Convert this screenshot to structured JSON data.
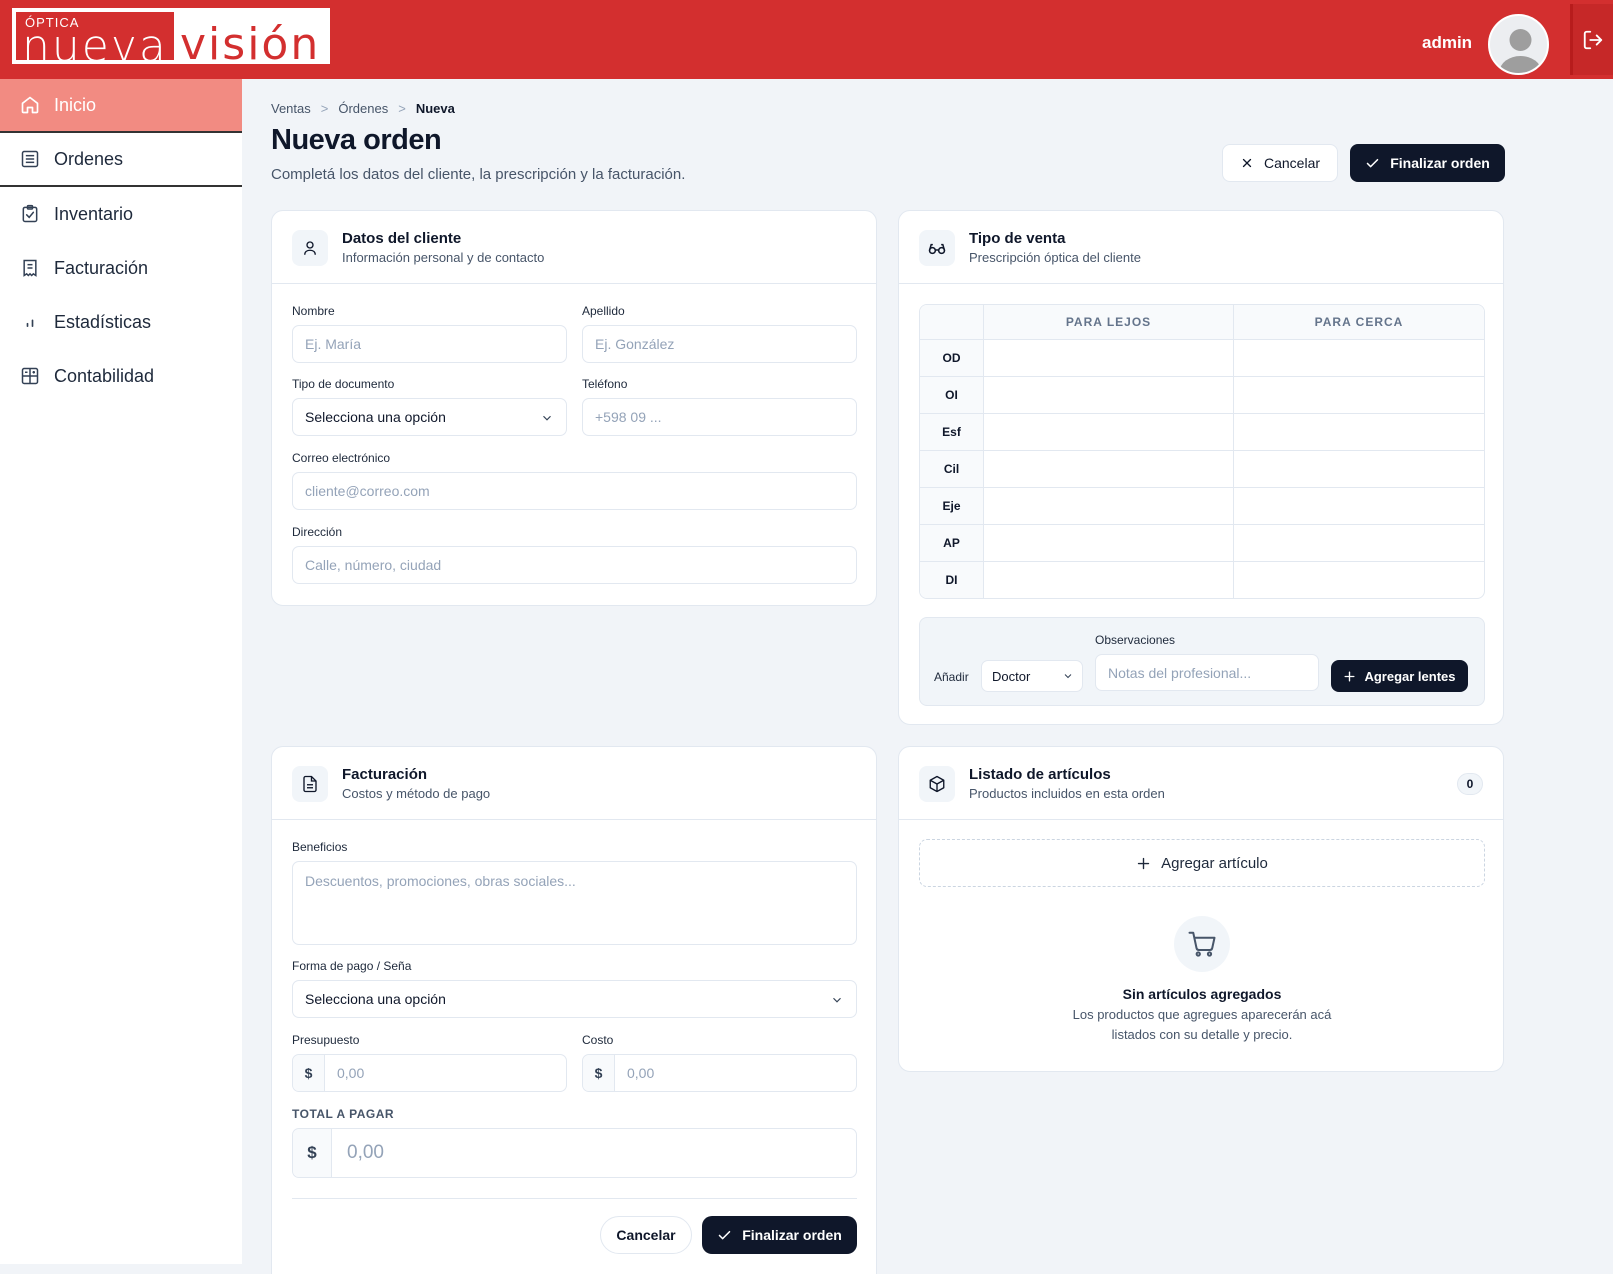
{
  "brand": {
    "small": "ÓPTICA",
    "word1": "nueva",
    "word2": "visión"
  },
  "header": {
    "user": "admin"
  },
  "sidebar": {
    "items": [
      {
        "label": "Inicio"
      },
      {
        "label": "Ordenes"
      },
      {
        "label": "Inventario"
      },
      {
        "label": "Facturación"
      },
      {
        "label": "Estadísticas"
      },
      {
        "label": "Contabilidad"
      }
    ]
  },
  "breadcrumb": {
    "first": "Ventas",
    "second": "Órdenes",
    "current": "Nueva",
    "sep": ">"
  },
  "page": {
    "title": "Nueva orden",
    "subtitle": "Completá los datos del cliente, la prescripción y la facturación.",
    "cancel": "Cancelar",
    "finish": "Finalizar orden"
  },
  "cliente": {
    "title": "Datos del cliente",
    "subtitle": "Información personal y de contacto",
    "nombre_label": "Nombre",
    "nombre_ph": "Ej. María",
    "apellido_label": "Apellido",
    "apellido_ph": "Ej. González",
    "tipo_doc_label": "Tipo de documento",
    "tipo_doc_value": "Selecciona una opción",
    "telefono_label": "Teléfono",
    "telefono_ph": "+598 09 ...",
    "correo_label": "Correo electrónico",
    "correo_ph": "cliente@correo.com",
    "direccion_label": "Dirección",
    "direccion_ph": "Calle, número, ciudad"
  },
  "venta": {
    "title": "Tipo de venta",
    "subtitle": "Prescripción óptica del cliente",
    "col_lejos": "PARA LEJOS",
    "col_cerca": "PARA CERCA",
    "rows": [
      "OD",
      "OI",
      "Esf",
      "Cil",
      "Eje",
      "AP",
      "DI"
    ],
    "obs_label": "Observaciones",
    "anadir_label": "Añadir",
    "doctor_value": "Doctor",
    "obs_ph": "Notas del profesional...",
    "add_lentes": "Agregar lentes"
  },
  "facturacion": {
    "title": "Facturación",
    "subtitle": "Costos y método de pago",
    "beneficios_label": "Beneficios",
    "beneficios_ph": "Descuentos, promociones, obras sociales...",
    "forma_pago_label": "Forma de pago / Seña",
    "forma_pago_value": "Selecciona una opción",
    "presupuesto_label": "Presupuesto",
    "presupuesto_ph": "0,00",
    "costo_label": "Costo",
    "costo_ph": "0,00",
    "currency": "$",
    "total_label": "TOTAL A PAGAR",
    "total_value": "0,00",
    "cancel": "Cancelar",
    "finish": "Finalizar orden"
  },
  "articulos": {
    "title": "Listado de artículos",
    "subtitle": "Productos incluidos en esta orden",
    "count": "0",
    "add": "Agregar artículo",
    "empty_title": "Sin artículos agregados",
    "empty_line1": "Los productos que agregues aparecerán acá",
    "empty_line2": "listados con su detalle y precio."
  },
  "colors": {
    "brand": "#d32f2f",
    "active_nav": "#f28b82",
    "dark": "#0f172a"
  },
  "icons": [
    "home-icon",
    "list-icon",
    "clipboard-check-icon",
    "receipt-icon",
    "bar-chart-icon",
    "calculator-icon",
    "logout-icon",
    "user-icon",
    "glasses-icon",
    "file-text-icon",
    "box-icon",
    "cart-icon",
    "check-icon",
    "x-icon",
    "plus-icon",
    "chevron-down-icon"
  ]
}
